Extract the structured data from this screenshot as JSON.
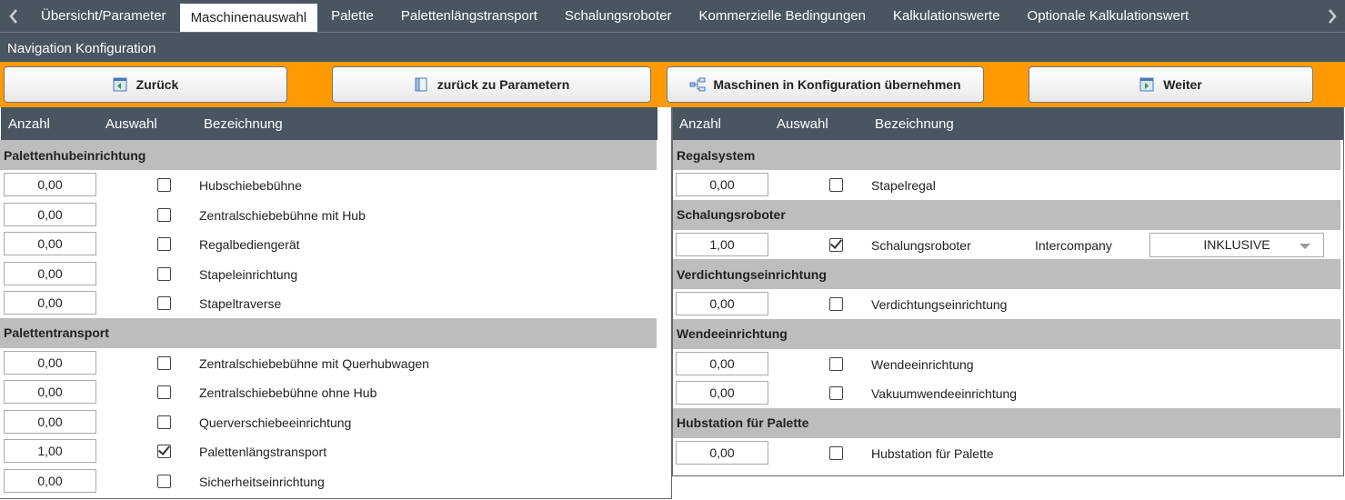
{
  "tabs": {
    "items": [
      "Übersicht/Parameter",
      "Maschinenauswahl",
      "Palette",
      "Palettenlängstransport",
      "Schalungsroboter",
      "Kommerzielle Bedingungen",
      "Kalkulationswerte",
      "Optionale Kalkulationswert"
    ],
    "active_index": 1
  },
  "nav": {
    "title": "Navigation Konfiguration",
    "back_label": "Zurück",
    "params_label": "zurück zu Parametern",
    "apply_label": "Maschinen in Konfiguration übernehmen",
    "next_label": "Weiter"
  },
  "columns": {
    "qty": "Anzahl",
    "select": "Auswahl",
    "name": "Bezeichnung"
  },
  "left_panel": {
    "groups": [
      {
        "title": "Palettenhubeinrichtung",
        "rows": [
          {
            "qty": "0,00",
            "checked": false,
            "label": "Hubschiebebühne"
          },
          {
            "qty": "0,00",
            "checked": false,
            "label": "Zentralschiebebühne mit Hub"
          },
          {
            "qty": "0,00",
            "checked": false,
            "label": "Regalbediengerät"
          },
          {
            "qty": "0,00",
            "checked": false,
            "label": "Stapeleinrichtung"
          },
          {
            "qty": "0,00",
            "checked": false,
            "label": "Stapeltraverse"
          }
        ]
      },
      {
        "title": "Palettentransport",
        "rows": [
          {
            "qty": "0,00",
            "checked": false,
            "label": "Zentralschiebebühne mit Querhubwagen"
          },
          {
            "qty": "0,00",
            "checked": false,
            "label": "Zentralschiebebühne ohne Hub"
          },
          {
            "qty": "0,00",
            "checked": false,
            "label": "Querverschiebeeinrichtung"
          },
          {
            "qty": "1,00",
            "checked": true,
            "label": "Palettenlängstransport"
          },
          {
            "qty": "0,00",
            "checked": false,
            "label": "Sicherheitseinrichtung"
          }
        ]
      }
    ]
  },
  "right_panel": {
    "groups": [
      {
        "title": "Regalsystem",
        "rows": [
          {
            "qty": "0,00",
            "checked": false,
            "label": "Stapelregal"
          }
        ]
      },
      {
        "title": "Schalungsroboter",
        "rows": [
          {
            "qty": "1,00",
            "checked": true,
            "label": "Schalungsroboter",
            "extra_label": "Intercompany",
            "select_value": "INKLUSIVE"
          }
        ]
      },
      {
        "title": "Verdichtungseinrichtung",
        "rows": [
          {
            "qty": "0,00",
            "checked": false,
            "label": "Verdichtungseinrichtung"
          }
        ]
      },
      {
        "title": "Wendeeinrichtung",
        "rows": [
          {
            "qty": "0,00",
            "checked": false,
            "label": "Wendeeinrichtung"
          },
          {
            "qty": "0,00",
            "checked": false,
            "label": "Vakuumwendeeinrichtung"
          }
        ]
      },
      {
        "title": "Hubstation für Palette",
        "rows": [
          {
            "qty": "0,00",
            "checked": false,
            "label": "Hubstation für Palette"
          }
        ]
      }
    ]
  },
  "colors": {
    "header_bg": "#4a5562",
    "accent_orange": "#ff9a00",
    "group_bg": "#bdbdbd"
  }
}
